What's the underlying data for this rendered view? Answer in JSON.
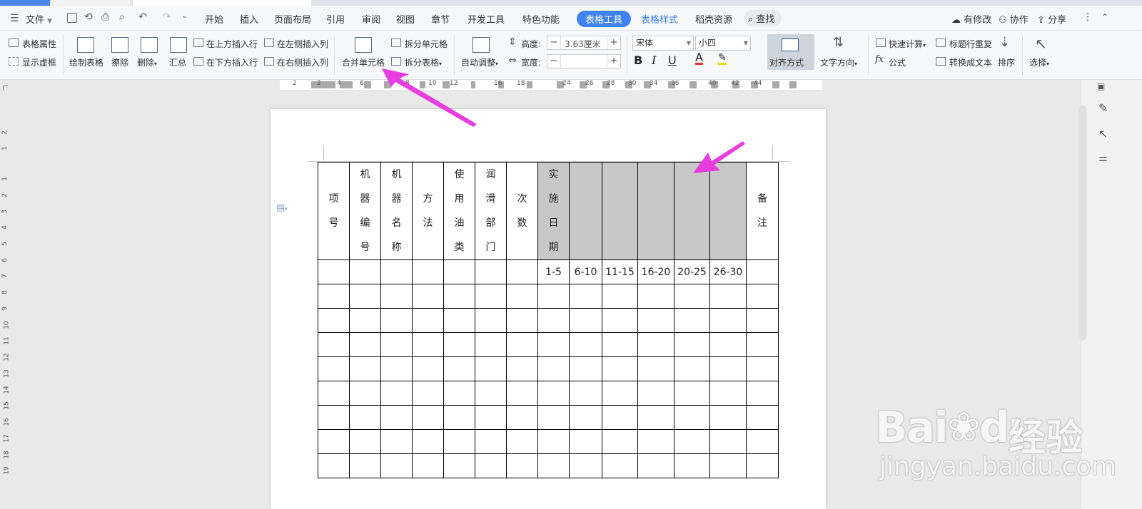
{
  "menu": {
    "file_label": "文件",
    "tabs": [
      "开始",
      "插入",
      "页面布局",
      "引用",
      "审阅",
      "视图",
      "章节",
      "开发工具",
      "特色功能",
      "表格工具",
      "表格样式",
      "稻壳资源"
    ],
    "active_tab": "表格工具",
    "search_label": "查找",
    "status_label": "有修改",
    "collab_label": "协作",
    "share_label": "分享"
  },
  "ribbon": {
    "table_props": "表格属性",
    "show_gridlines": "显示虚框",
    "draw_table": "绘制表格",
    "erase": "擦除",
    "delete": "删除",
    "summary": "汇总",
    "insert_above": "在上方插入行",
    "insert_below": "在下方插入行",
    "insert_left": "在左侧插入列",
    "insert_right": "在右侧插入列",
    "merge_cells": "合并单元格",
    "split_cells": "拆分单元格",
    "split_table": "拆分表格",
    "auto_fit": "自动调整",
    "height_label": "高度:",
    "height_value": "3.63厘米",
    "width_label": "宽度:",
    "width_value": "",
    "font_name": "宋体",
    "font_size": "小四",
    "align": "对齐方式",
    "text_direction": "文字方向",
    "quick_calc": "快速计算",
    "formula": "公式",
    "repeat_header": "标题行重复",
    "to_text": "转换成文本",
    "sort": "排序",
    "select": "选择",
    "minus": "−",
    "plus": "+"
  },
  "ruler": {
    "h_numbers": [
      "2",
      "2",
      "4",
      "6",
      "8",
      "10",
      "12",
      "16",
      "18",
      "24",
      "26",
      "28",
      "30",
      "34",
      "36",
      "40",
      "42",
      "44"
    ],
    "v_numbers": [
      "2",
      "1",
      "1",
      "2",
      "3",
      "4",
      "5",
      "6",
      "7",
      "8",
      "9",
      "10",
      "11",
      "12",
      "13",
      "14",
      "15",
      "16",
      "17",
      "18",
      "19"
    ]
  },
  "table": {
    "headers": {
      "item_no": [
        "项",
        "号"
      ],
      "machine_no": [
        "机",
        "器",
        "编",
        "号"
      ],
      "machine_name": [
        "机",
        "器",
        "名",
        "称"
      ],
      "method": [
        "方",
        "法"
      ],
      "oil_type": [
        "使",
        "用",
        "油",
        "类"
      ],
      "lube_part": [
        "润",
        "滑",
        "部",
        "门"
      ],
      "times": [
        "次",
        "数"
      ],
      "date": [
        "实",
        "施",
        "日",
        "期"
      ],
      "remark": [
        "备",
        "注"
      ]
    },
    "date_ranges": [
      "1-5",
      "6-10",
      "11-15",
      "16-20",
      "20-25",
      "26-30"
    ],
    "empty_rows": 8
  },
  "watermark": {
    "logo": "Bai",
    "logo_suffix": "du",
    "brand": "经验",
    "url": "jingyan.baidu.com"
  },
  "colors": {
    "accent": "#4083f0",
    "arrow": "#e83ee0",
    "highlight_cell": "#c8c8c8"
  }
}
